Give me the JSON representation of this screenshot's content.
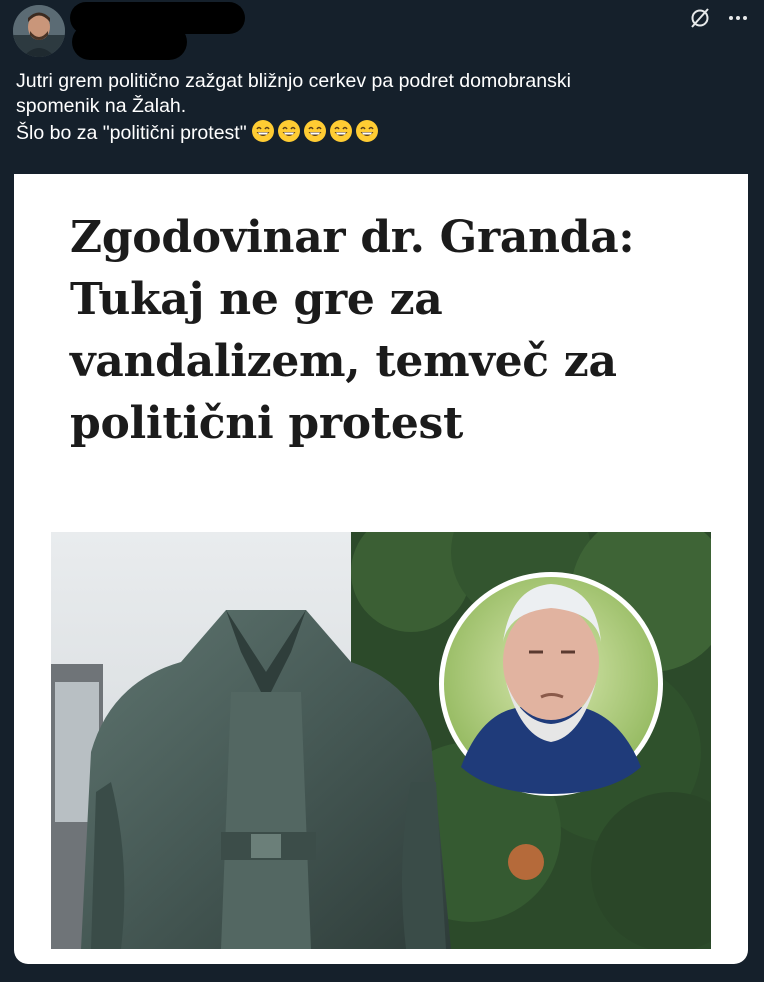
{
  "tweet": {
    "line1": "Jutri grem politično zažgat bližnjo cerkev pa podret domobranski",
    "line2": "spomenik na Žalah.",
    "line3": "Šlo bo za \"politični protest\"",
    "emojis": [
      "😄",
      "😄",
      "😄",
      "😄",
      "😄"
    ]
  },
  "article": {
    "headline_1": "Zgodovinar dr. Granda:",
    "headline_2": "Tukaj ne gre za",
    "headline_3": "vandalizem, temveč za",
    "headline_4": "politični protest"
  },
  "icons": {
    "avatar": "profile-avatar",
    "grok": "grok-icon",
    "more": "more-options-icon"
  },
  "colors": {
    "background": "#15202b",
    "card": "#ffffff",
    "headline": "#1b1b1b"
  }
}
